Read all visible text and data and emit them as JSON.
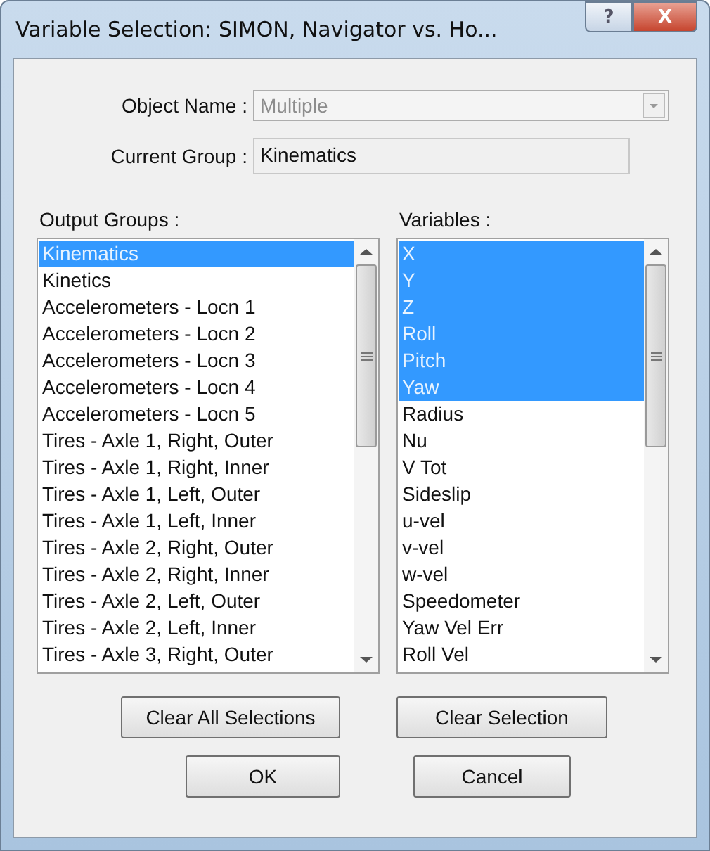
{
  "window": {
    "title": "Variable Selection: SIMON, Navigator vs. Ho...",
    "help_button": "?",
    "close_button": "X"
  },
  "object_name": {
    "label": "Object Name :",
    "value": "Multiple",
    "disabled": true
  },
  "current_group": {
    "label": "Current Group :",
    "value": "Kinematics"
  },
  "output_groups": {
    "label": "Output Groups :",
    "items": [
      {
        "label": "Kinematics",
        "selected": true
      },
      {
        "label": "Kinetics",
        "selected": false
      },
      {
        "label": "Accelerometers - Locn 1",
        "selected": false
      },
      {
        "label": "Accelerometers - Locn 2",
        "selected": false
      },
      {
        "label": "Accelerometers - Locn 3",
        "selected": false
      },
      {
        "label": "Accelerometers - Locn 4",
        "selected": false
      },
      {
        "label": "Accelerometers - Locn 5",
        "selected": false
      },
      {
        "label": "Tires - Axle 1, Right, Outer",
        "selected": false
      },
      {
        "label": "Tires - Axle 1, Right, Inner",
        "selected": false
      },
      {
        "label": "Tires - Axle 1, Left, Outer",
        "selected": false
      },
      {
        "label": "Tires - Axle 1, Left, Inner",
        "selected": false
      },
      {
        "label": "Tires - Axle 2, Right, Outer",
        "selected": false
      },
      {
        "label": "Tires - Axle 2, Right, Inner",
        "selected": false
      },
      {
        "label": "Tires - Axle 2, Left, Outer",
        "selected": false
      },
      {
        "label": "Tires - Axle 2, Left, Inner",
        "selected": false
      },
      {
        "label": "Tires - Axle 3, Right, Outer",
        "selected": false
      }
    ]
  },
  "variables": {
    "label": "Variables :",
    "items": [
      {
        "label": "X",
        "selected": true
      },
      {
        "label": "Y",
        "selected": true
      },
      {
        "label": "Z",
        "selected": true
      },
      {
        "label": "Roll",
        "selected": true
      },
      {
        "label": "Pitch",
        "selected": true
      },
      {
        "label": "Yaw",
        "selected": true
      },
      {
        "label": "Radius",
        "selected": false
      },
      {
        "label": "Nu",
        "selected": false
      },
      {
        "label": "V Tot",
        "selected": false
      },
      {
        "label": "Sideslip",
        "selected": false
      },
      {
        "label": "u-vel",
        "selected": false
      },
      {
        "label": "v-vel",
        "selected": false
      },
      {
        "label": "w-vel",
        "selected": false
      },
      {
        "label": "Speedometer",
        "selected": false
      },
      {
        "label": "Yaw Vel Err",
        "selected": false
      },
      {
        "label": "Roll Vel",
        "selected": false
      }
    ]
  },
  "buttons": {
    "clear_all": "Clear All Selections",
    "clear_selection": "Clear Selection",
    "ok": "OK",
    "cancel": "Cancel"
  }
}
